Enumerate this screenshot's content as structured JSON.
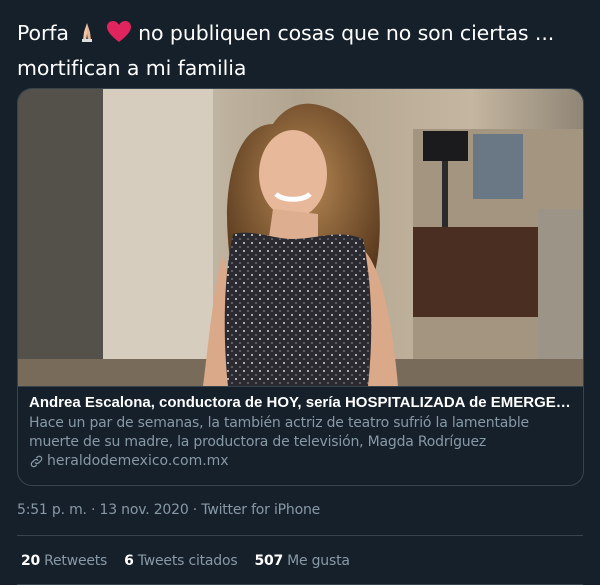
{
  "tweet": {
    "text_part1": "Porfa",
    "emojis": [
      "folded-hands-icon",
      "red-heart-icon"
    ],
    "text_part2": "no publiquen cosas que no son ciertas ...",
    "text_line2": "mortifican a mi familia"
  },
  "card": {
    "title": "Andrea Escalona, conductora de HOY, sería HOSPITALIZADA de EMERGENCIA",
    "description": "Hace un par de semanas, la también actriz de teatro sufrió la lamentable muerte de su madre, la productora de televisión, Magda Rodríguez",
    "domain": "heraldodemexico.com.mx",
    "image_icon": "woman-portrait-photo"
  },
  "meta": {
    "timestamp": "5:51 p. m. · 13 nov. 2020 · Twitter for iPhone"
  },
  "stats": {
    "retweets_count": "20",
    "retweets_label": "Retweets",
    "quotes_count": "6",
    "quotes_label": "Tweets citados",
    "likes_count": "507",
    "likes_label": "Me gusta"
  },
  "colors": {
    "background": "#15202b",
    "border": "#38444d",
    "secondary_text": "#8899a6",
    "heart": "#e0245e"
  }
}
